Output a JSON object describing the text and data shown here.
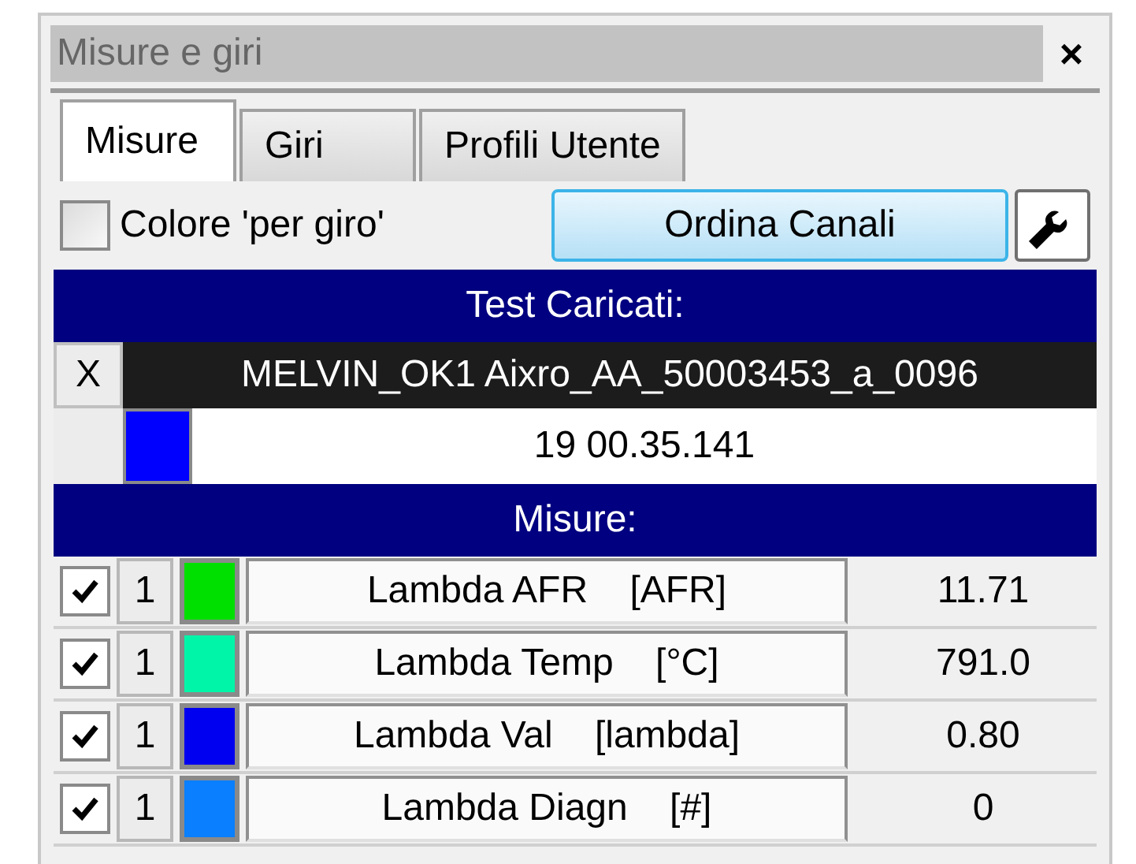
{
  "window": {
    "title": "Misure e giri",
    "close": "×"
  },
  "tabs": [
    {
      "label": "Misure",
      "selected": true
    },
    {
      "label": "Giri",
      "selected": false
    },
    {
      "label": "Profili Utente",
      "selected": false
    }
  ],
  "toolbar": {
    "color_per_lap": {
      "label": "Colore 'per giro'",
      "checked": false
    },
    "sort_button": "Ordina Canali"
  },
  "tests": {
    "header": "Test Caricati:",
    "remove": "X",
    "name": "MELVIN_OK1 Aixro_AA_50003453_a_0096",
    "color": "#0000ff",
    "time": "19 00.35.141"
  },
  "measures": {
    "header": "Misure:",
    "rows": [
      {
        "checked": true,
        "lap": "1",
        "color": "#00e000",
        "label": "Lambda AFR    [AFR]",
        "value": "11.71"
      },
      {
        "checked": true,
        "lap": "1",
        "color": "#00f5a8",
        "label": "Lambda Temp    [°C]",
        "value": "791.0"
      },
      {
        "checked": true,
        "lap": "1",
        "color": "#0000f0",
        "label": "Lambda Val    [lambda]",
        "value": "0.80"
      },
      {
        "checked": true,
        "lap": "1",
        "color": "#0a7fff",
        "label": "Lambda Diagn    [#]",
        "value": "0"
      }
    ]
  }
}
